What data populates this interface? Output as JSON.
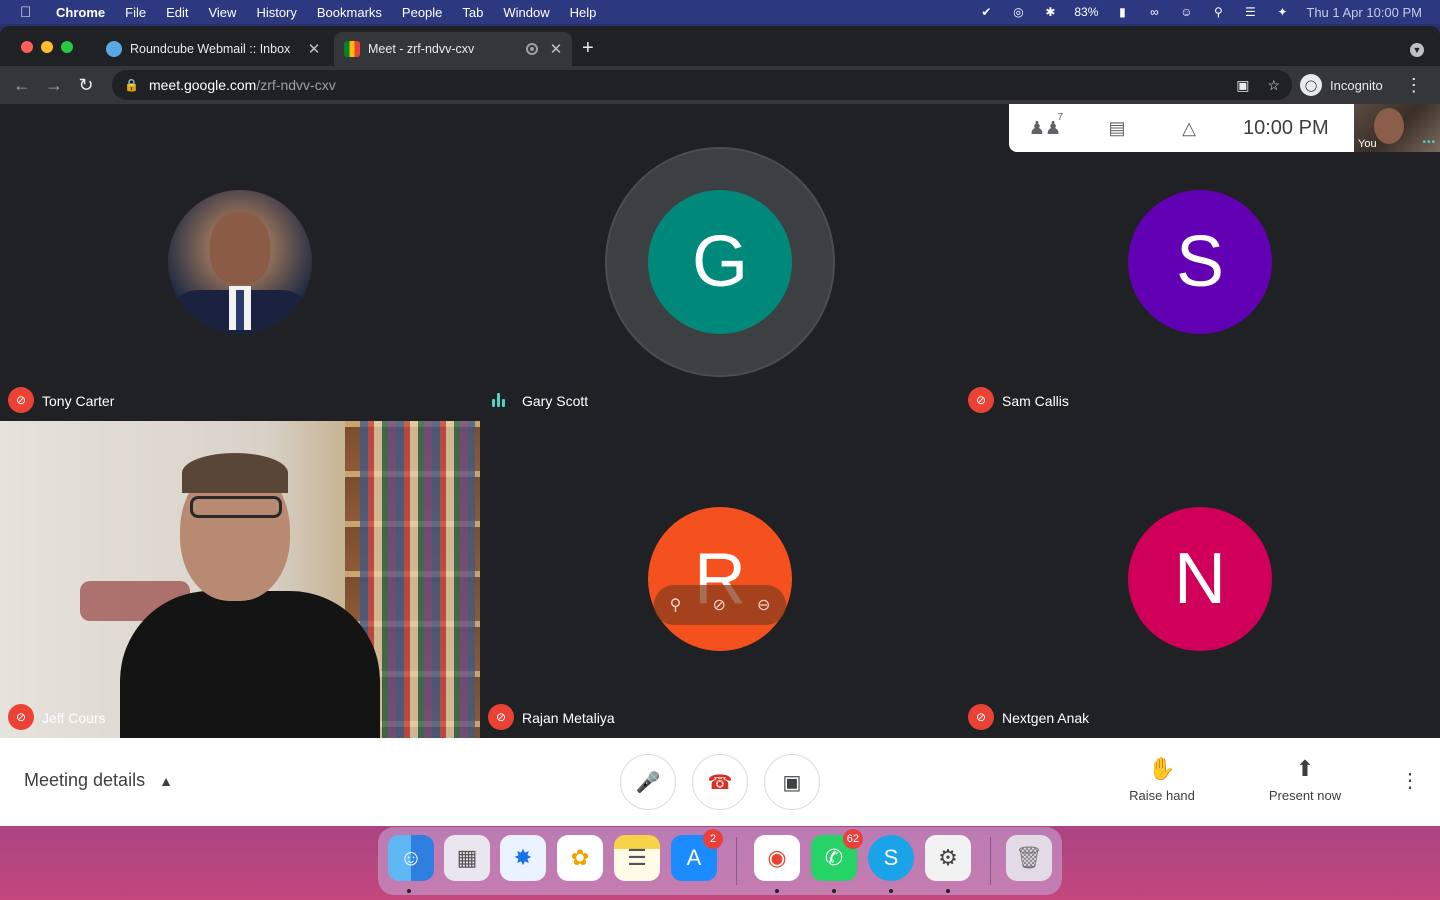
{
  "menubar": {
    "app": "Chrome",
    "items": [
      "File",
      "Edit",
      "View",
      "History",
      "Bookmarks",
      "People",
      "Tab",
      "Window",
      "Help"
    ],
    "battery": "83%",
    "datetime": "Thu 1 Apr  10:00 PM"
  },
  "browser": {
    "tabs": [
      {
        "title": "Roundcube Webmail :: Inbox"
      },
      {
        "title": "Meet - zrf-ndvv-cxv"
      }
    ],
    "url_host": "meet.google.com",
    "url_path": "/zrf-ndvv-cxv",
    "profile": "Incognito"
  },
  "meet": {
    "topbar": {
      "participants_count": "7",
      "clock": "10:00 PM",
      "self_label": "You"
    },
    "tiles": [
      {
        "name": "Tony Carter",
        "initial": ""
      },
      {
        "name": "Gary Scott",
        "initial": "G",
        "color": "#00897b"
      },
      {
        "name": "Sam Callis",
        "initial": "S",
        "color": "#6200b3"
      },
      {
        "name": "Jeff Cours",
        "initial": ""
      },
      {
        "name": "Rajan Metaliya",
        "initial": "R",
        "color": "#f4511e"
      },
      {
        "name": "Nextgen Anak",
        "initial": "N",
        "color": "#d0005a"
      }
    ],
    "bottombar": {
      "meeting_details": "Meeting details",
      "raise_hand": "Raise hand",
      "present_now": "Present now"
    }
  },
  "dock": {
    "appstore_badge": "2",
    "whatsapp_badge": "62"
  }
}
